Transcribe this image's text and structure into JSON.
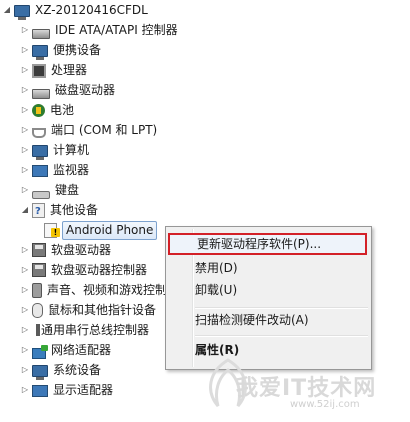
{
  "root": {
    "label": "XZ-20120416CFDL",
    "icon": "computer-root-icon"
  },
  "devices": [
    {
      "id": "ide",
      "label": "IDE ATA/ATAPI 控制器",
      "icon": "ide-controller-icon",
      "expanded": false
    },
    {
      "id": "portable",
      "label": "便携设备",
      "icon": "portable-device-icon",
      "expanded": false
    },
    {
      "id": "cpu",
      "label": "处理器",
      "icon": "processor-icon",
      "expanded": false
    },
    {
      "id": "diskdrive",
      "label": "磁盘驱动器",
      "icon": "disk-drive-icon",
      "expanded": false
    },
    {
      "id": "battery",
      "label": "电池",
      "icon": "battery-icon",
      "expanded": false
    },
    {
      "id": "ports",
      "label": "端口 (COM 和 LPT)",
      "icon": "port-icon",
      "expanded": false
    },
    {
      "id": "computer",
      "label": "计算机",
      "icon": "computer-icon",
      "expanded": false
    },
    {
      "id": "monitor",
      "label": "监视器",
      "icon": "monitor-icon",
      "expanded": false
    },
    {
      "id": "keyboard",
      "label": "键盘",
      "icon": "keyboard-icon",
      "expanded": false
    },
    {
      "id": "other",
      "label": "其他设备",
      "icon": "unknown-device-icon",
      "expanded": true
    },
    {
      "id": "android",
      "label": "Android Phone",
      "icon": "warning-device-icon",
      "child": true,
      "selected": true
    },
    {
      "id": "floppy",
      "label": "软盘驱动器",
      "icon": "floppy-drive-icon",
      "expanded": false
    },
    {
      "id": "floppyctrl",
      "label": "软盘驱动器控制器",
      "icon": "floppy-controller-icon",
      "expanded": false
    },
    {
      "id": "sound",
      "label": "声音、视频和游戏控制器",
      "icon": "sound-icon",
      "expanded": false
    },
    {
      "id": "mouse",
      "label": "鼠标和其他指针设备",
      "icon": "mouse-icon",
      "expanded": false
    },
    {
      "id": "usb",
      "label": "通用串行总线控制器",
      "icon": "usb-icon",
      "expanded": false
    },
    {
      "id": "network",
      "label": "网络适配器",
      "icon": "network-adapter-icon",
      "expanded": false
    },
    {
      "id": "system",
      "label": "系统设备",
      "icon": "system-device-icon",
      "expanded": false
    },
    {
      "id": "display",
      "label": "显示适配器",
      "icon": "display-adapter-icon",
      "expanded": false
    }
  ],
  "context_menu": {
    "items": [
      {
        "label": "更新驱动程序软件(P)...",
        "highlighted": true
      },
      {
        "label": "禁用(D)"
      },
      {
        "label": "卸载(U)"
      },
      {
        "label": "扫描检测硬件改动(A)"
      },
      {
        "label": "属性(R)",
        "bold": true
      }
    ]
  },
  "watermark": {
    "text": "我爱IT技术网",
    "url": "www.52ij.com"
  }
}
